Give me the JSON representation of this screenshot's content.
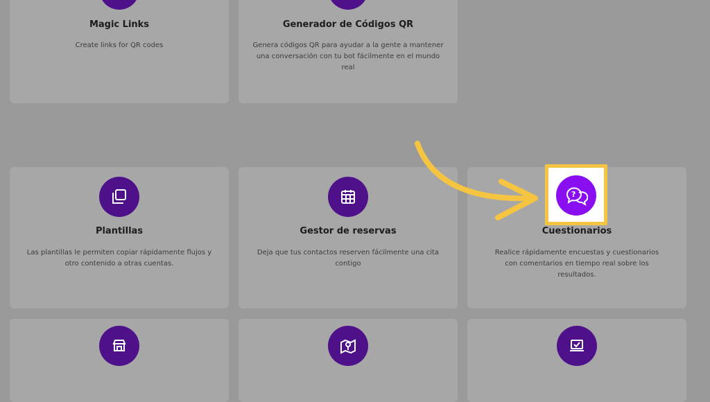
{
  "colors": {
    "overlay_bg": "#9a9a9a",
    "card_bg": "#a7a7a7",
    "icon_circle_dim": "#4f118a",
    "icon_circle_active": "#8a0ff0",
    "highlight_border": "#f5c542",
    "arrow": "#f5c542"
  },
  "cards": [
    {
      "title": "Magic Links",
      "description": "Create links for QR codes",
      "icon": "link-icon"
    },
    {
      "title": "Generador de Códigos QR",
      "description": "Genera códigos QR para ayudar a la gente a mantener una conversación con tu bot fácilmente en el mundo real",
      "icon": "qr-icon"
    },
    {
      "title": "Plantillas",
      "description": "Las plantillas le permiten copiar rápidamente flujos y otro contenido a otras cuentas.",
      "icon": "copy-icon"
    },
    {
      "title": "Gestor de reservas",
      "description": "Deja que tus contactos reserven fácilmente una cita contigo",
      "icon": "calendar-icon"
    },
    {
      "title": "Cuestionarios",
      "description": "Realice rápidamente encuestas y cuestionarios con comentarios en tiempo real sobre los resultados.",
      "icon": "question-chat-icon"
    },
    {
      "title": "",
      "description": "",
      "icon": "store-icon"
    },
    {
      "title": "",
      "description": "",
      "icon": "map-pin-icon"
    },
    {
      "title": "",
      "description": "",
      "icon": "laptop-check-icon"
    }
  ]
}
